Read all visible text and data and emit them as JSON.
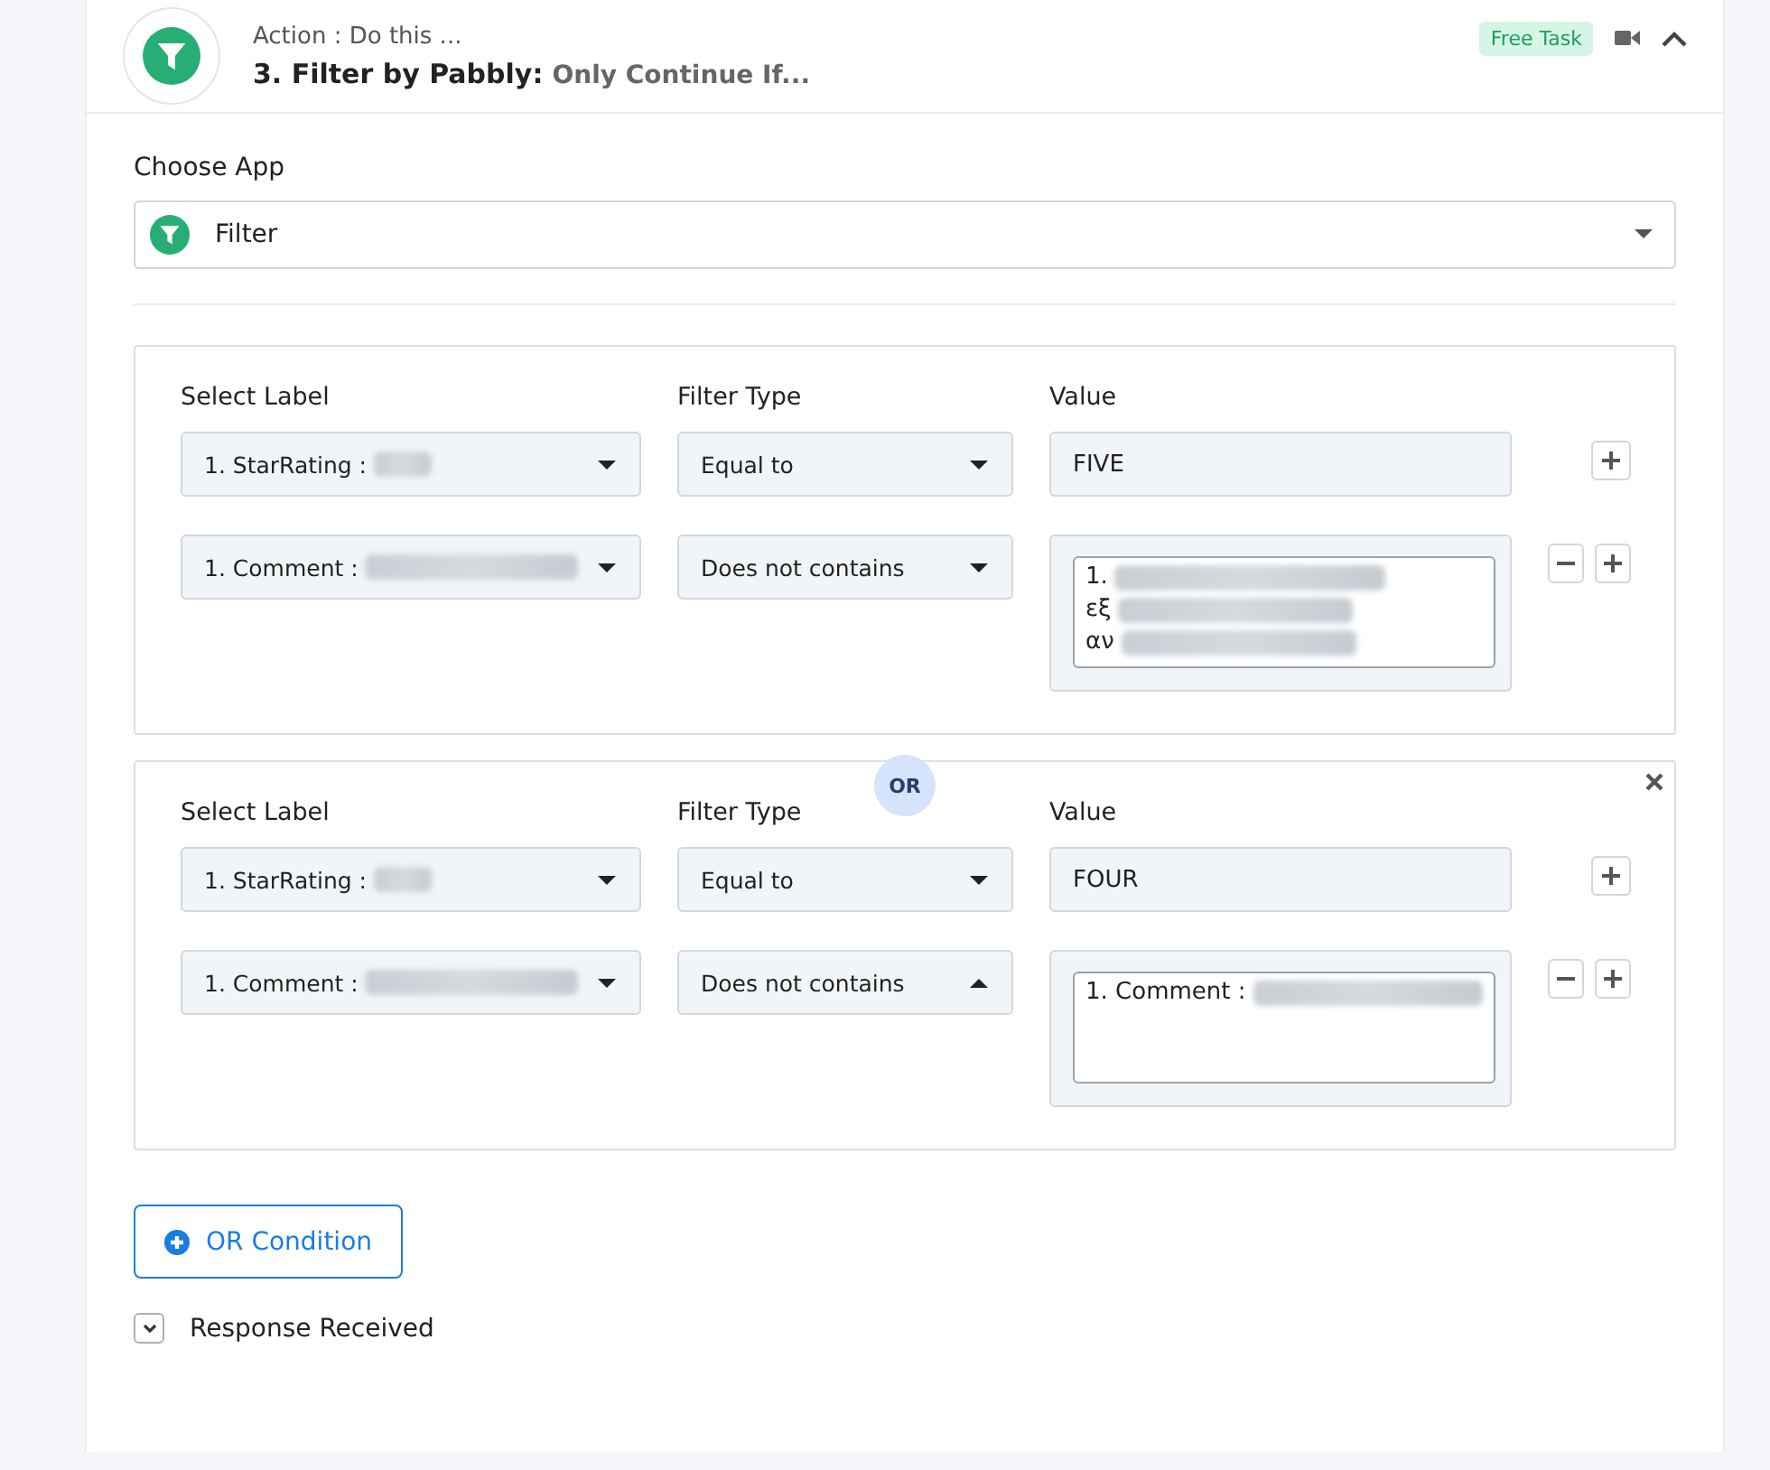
{
  "header": {
    "subtitle": "Action : Do this ...",
    "step": "3. Filter by Pabbly:",
    "description": "Only Continue If...",
    "badge": "Free Task",
    "expanded": true
  },
  "choose_app": {
    "label": "Choose App",
    "value": "Filter"
  },
  "groups": [
    {
      "closable": false,
      "columns": [
        "Select Label",
        "Filter Type",
        "Value"
      ],
      "rows": [
        {
          "label": "1. StarRating :",
          "filter_type": "Equal to",
          "dropdown_open": false,
          "kind": "input",
          "value": [
            "FIVE"
          ],
          "removable": false
        },
        {
          "label": "1. Comment :",
          "filter_type": "Does not contains",
          "dropdown_open": false,
          "kind": "textarea",
          "value": [
            "1.",
            "εξ",
            "αν"
          ],
          "removable": true
        }
      ]
    },
    {
      "closable": true,
      "columns": [
        "Select Label",
        "Filter Type",
        "Value"
      ],
      "rows": [
        {
          "label": "1. StarRating :",
          "filter_type": "Equal to",
          "dropdown_open": false,
          "kind": "input",
          "value": [
            "FOUR"
          ],
          "removable": false
        },
        {
          "label": "1. Comment :",
          "filter_type": "Does not contains",
          "dropdown_open": true,
          "kind": "textarea",
          "value": [
            "1. Comment :"
          ],
          "removable": true
        }
      ]
    }
  ],
  "separator": "OR",
  "add_button": "OR Condition",
  "response": {
    "label": "Response Received",
    "expanded": false
  }
}
